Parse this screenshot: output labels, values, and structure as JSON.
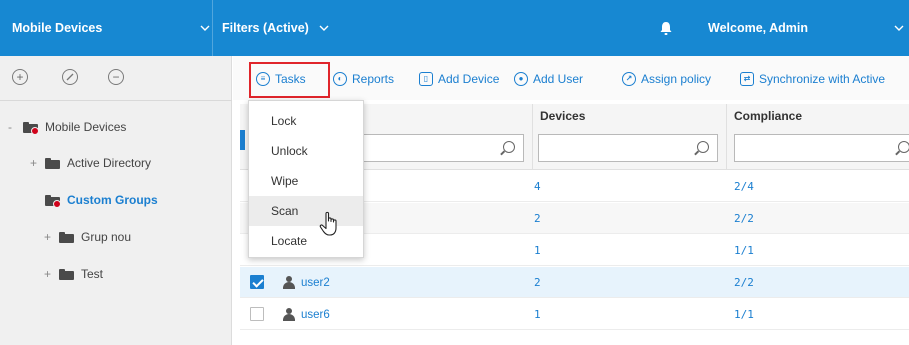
{
  "topbar": {
    "section": "Mobile Devices",
    "filters": "Filters (Active)",
    "welcome": "Welcome, Admin",
    "bg_color": "#1788d2",
    "bell_icon": "bell-icon"
  },
  "sidebar": {
    "actions": [
      "add-icon",
      "edit-icon",
      "remove-icon"
    ],
    "tree": [
      {
        "label": "Mobile Devices",
        "expander": "-"
      },
      {
        "label": "Active Directory",
        "expander": "+"
      },
      {
        "label": "Custom Groups",
        "expander": ""
      },
      {
        "label": "Grup nou",
        "expander": "+"
      },
      {
        "label": "Test",
        "expander": "+"
      }
    ]
  },
  "toolbar": {
    "tasks": "Tasks",
    "reports": "Reports",
    "add_device": "Add Device",
    "add_user": "Add User",
    "assign_policy": "Assign policy",
    "sync": "Synchronize with Active",
    "accent_color": "#1b7fd0"
  },
  "tasks_menu": {
    "items": [
      "Lock",
      "Unlock",
      "Wipe",
      "Scan",
      "Locate"
    ],
    "hovered": "Scan"
  },
  "grid": {
    "columns": {
      "devices": "Devices",
      "compliance": "Compliance"
    },
    "rows": [
      {
        "name": "",
        "devices": "4",
        "compliance": "2/4",
        "checked": false
      },
      {
        "name": "",
        "devices": "2",
        "compliance": "2/2",
        "checked": false
      },
      {
        "name": "",
        "devices": "1",
        "compliance": "1/1",
        "checked": false
      },
      {
        "name": "user2",
        "devices": "2",
        "compliance": "2/2",
        "checked": true
      },
      {
        "name": "user6",
        "devices": "1",
        "compliance": "1/1",
        "checked": false
      }
    ]
  }
}
